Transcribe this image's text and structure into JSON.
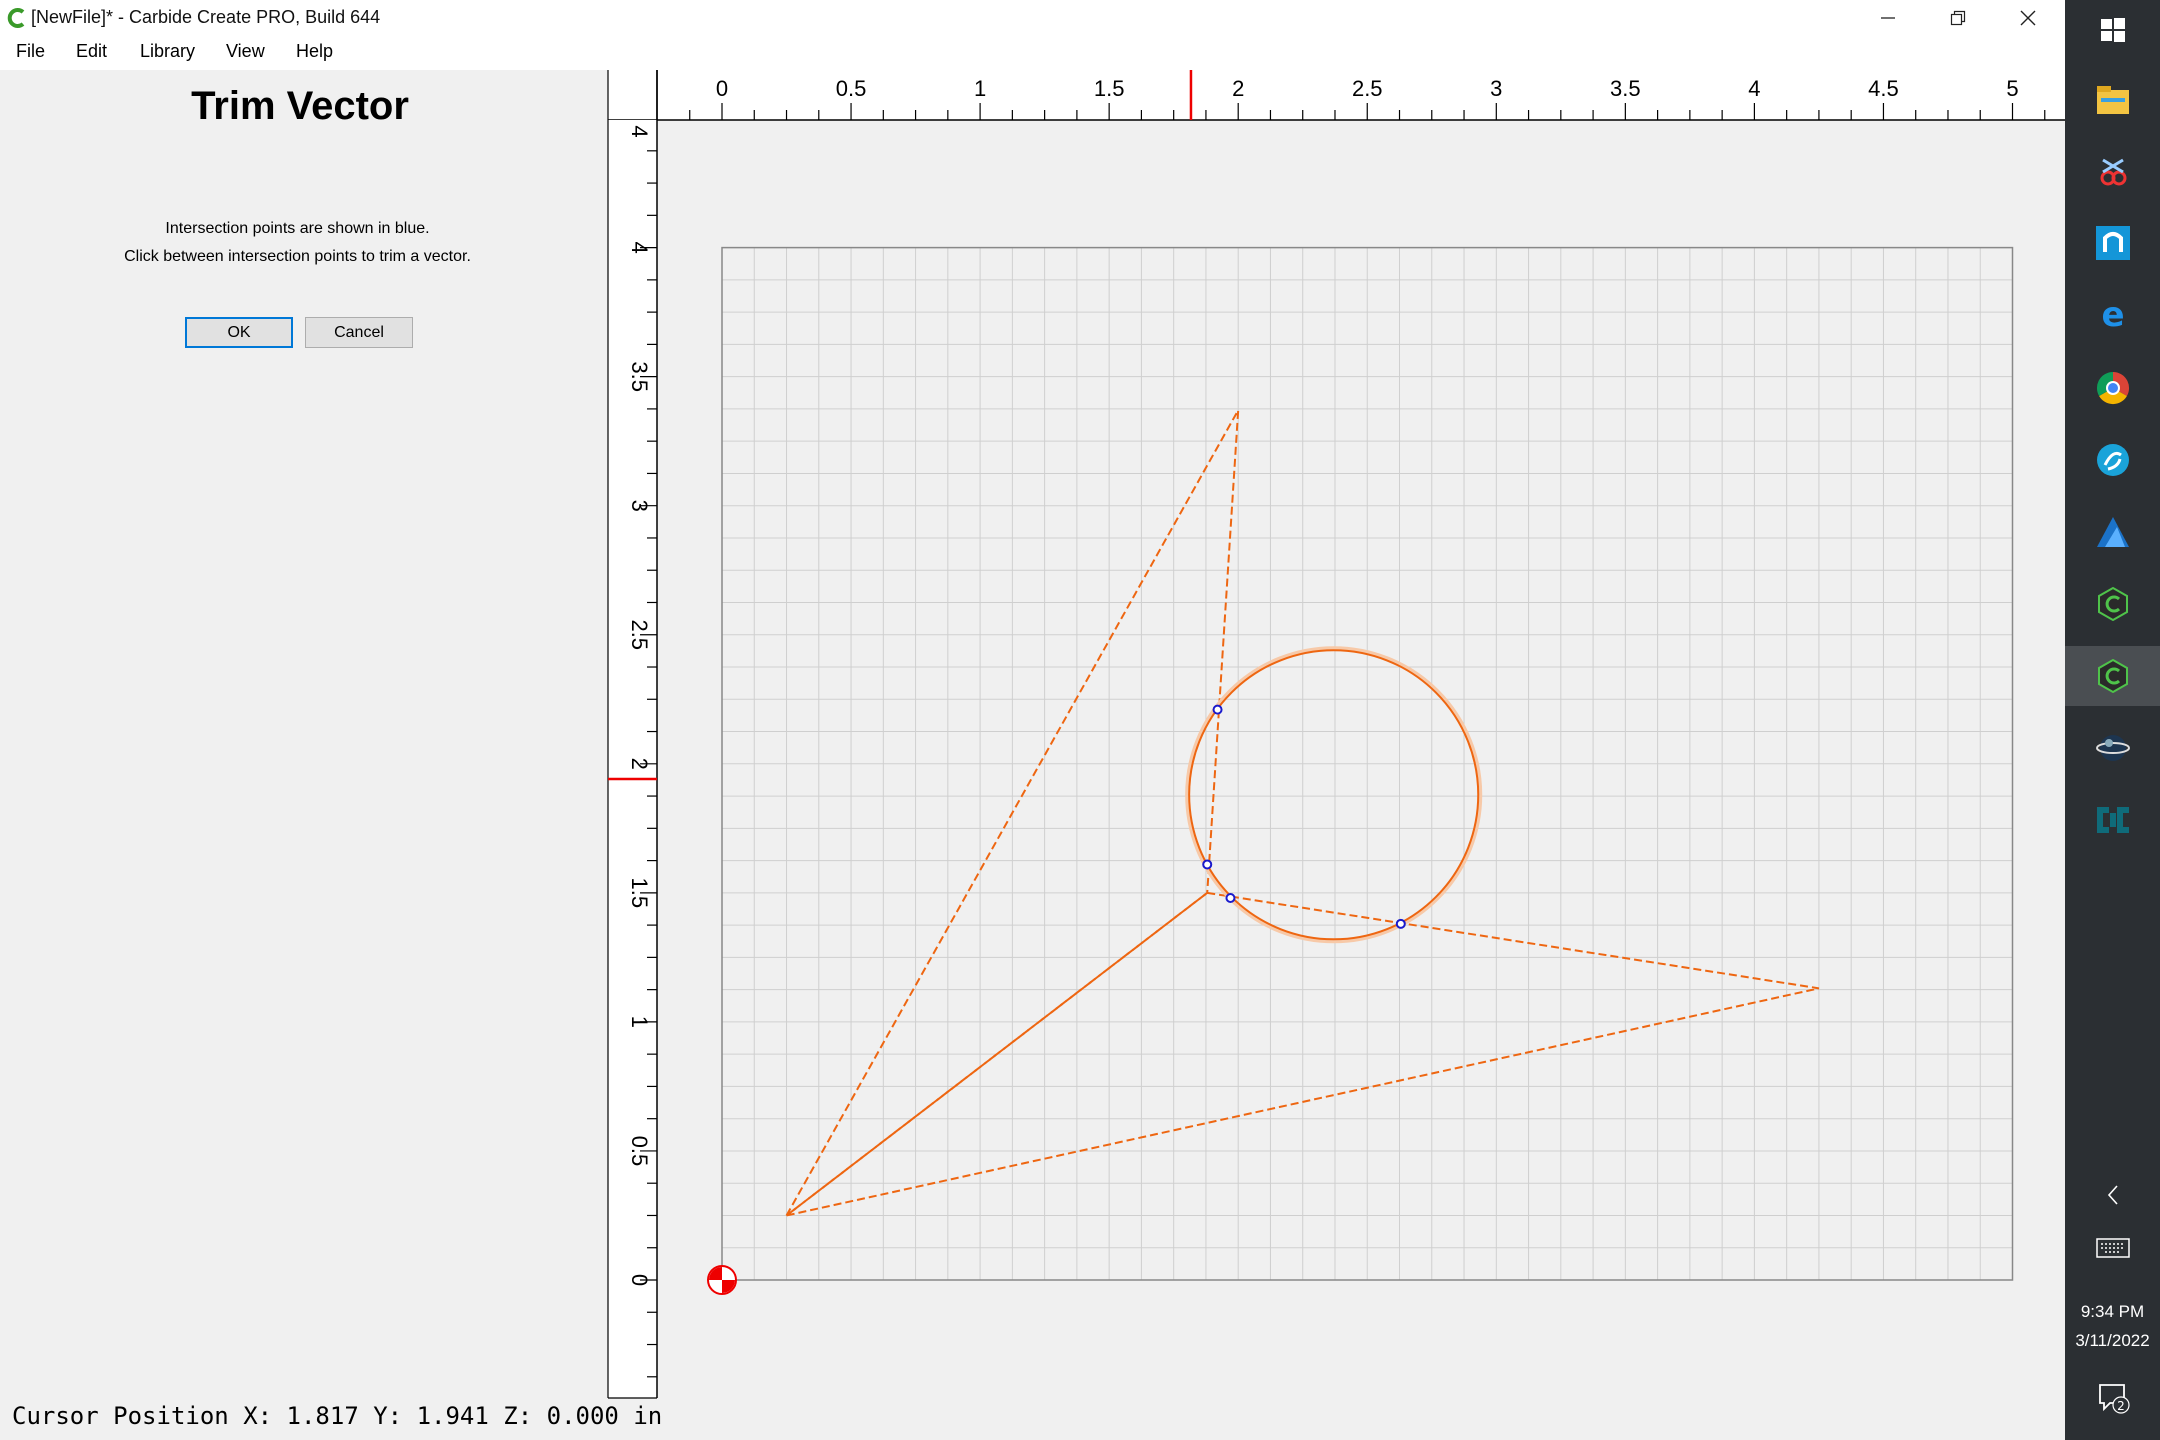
{
  "window": {
    "title": "[NewFile]* - Carbide Create PRO, Build 644"
  },
  "menu": {
    "items": [
      {
        "label": "File"
      },
      {
        "label": "Edit"
      },
      {
        "label": "Library"
      },
      {
        "label": "View"
      },
      {
        "label": "Help"
      }
    ]
  },
  "panel": {
    "title": "Trim Vector",
    "line1": "Intersection points are shown in blue.",
    "line2": "Click between intersection points to trim a vector.",
    "ok_label": "OK",
    "cancel_label": "Cancel"
  },
  "rulers": {
    "x_labels": [
      "0",
      "0.5",
      "1",
      "1.5",
      "2",
      "2.5",
      "3",
      "3.5",
      "4",
      "4.5",
      "5"
    ],
    "y_labels": [
      "0",
      "0.5",
      "1",
      "1.5",
      "2",
      "2.5",
      "3",
      "3.5",
      "4",
      "4"
    ],
    "cursor_marker": {
      "x": 1.817,
      "y": 1.941
    }
  },
  "drawing": {
    "units": "in",
    "grid_spacing": 0.125,
    "work_area": {
      "width": 5,
      "height": 4
    },
    "vector_color": "#ee6611",
    "intersection_color": "#1a1acc",
    "triangle1": [
      [
        0.25,
        0.25
      ],
      [
        2.0,
        3.37
      ],
      [
        1.88,
        1.5
      ]
    ],
    "triangle2": [
      [
        1.88,
        1.5
      ],
      [
        4.25,
        1.13
      ],
      [
        0.25,
        0.25
      ]
    ],
    "circle": {
      "cx": 2.37,
      "cy": 1.88,
      "r": 0.56
    },
    "intersections": [
      [
        1.92,
        2.21
      ],
      [
        1.88,
        1.61
      ],
      [
        1.97,
        1.48
      ],
      [
        2.63,
        1.38
      ]
    ]
  },
  "status": {
    "cursor_position": "Cursor Position X: 1.817 Y: 1.941 Z: 0.000 in"
  },
  "taskbar": {
    "icons": [
      "windows-logo-icon",
      "file-explorer-icon",
      "snipping-tool-icon",
      "app-n-icon",
      "edge-icon",
      "chrome-icon",
      "app-swirl-icon",
      "affinity-designer-icon",
      "carbide-create-icon",
      "carbide-create-active-icon",
      "globe-app-icon",
      "cnc-app-icon"
    ],
    "time": "9:34 PM",
    "date": "3/11/2022",
    "notification_count": "2"
  }
}
